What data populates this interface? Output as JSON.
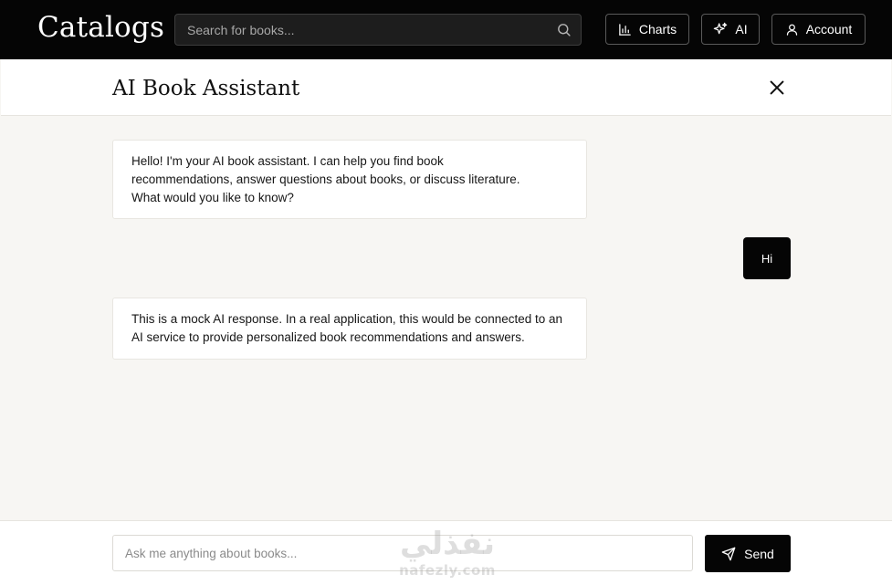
{
  "header": {
    "logo": "Catalogs",
    "search_placeholder": "Search for books...",
    "charts_label": "Charts",
    "ai_label": "AI",
    "account_label": "Account"
  },
  "panel": {
    "title": "AI Book Assistant"
  },
  "messages": [
    {
      "role": "assistant",
      "lines": [
        "Hello! I'm your AI book assistant. I can help you find book",
        "recommendations, answer questions about books, or discuss literature.",
        "What would you like to know?"
      ]
    },
    {
      "role": "user",
      "text": "Hi"
    },
    {
      "role": "assistant",
      "lines": [
        "This is a mock AI response. In a real application, this would be connected to an",
        "AI service to provide personalized book recommendations and answers."
      ]
    }
  ],
  "composer": {
    "placeholder": "Ask me anything about books...",
    "send_label": "Send"
  },
  "watermark": {
    "arabic": "نفذلي",
    "latin": "nafezly.com"
  },
  "icons": {
    "search": "search-icon",
    "charts": "bar-chart-icon",
    "ai": "sparkles-icon",
    "account": "user-icon",
    "close": "close-icon",
    "send": "send-icon"
  },
  "colors": {
    "topbar": "#050505",
    "page_bg": "#f7f6f3",
    "bubble_ai": "#ffffff",
    "bubble_user": "#050505"
  }
}
